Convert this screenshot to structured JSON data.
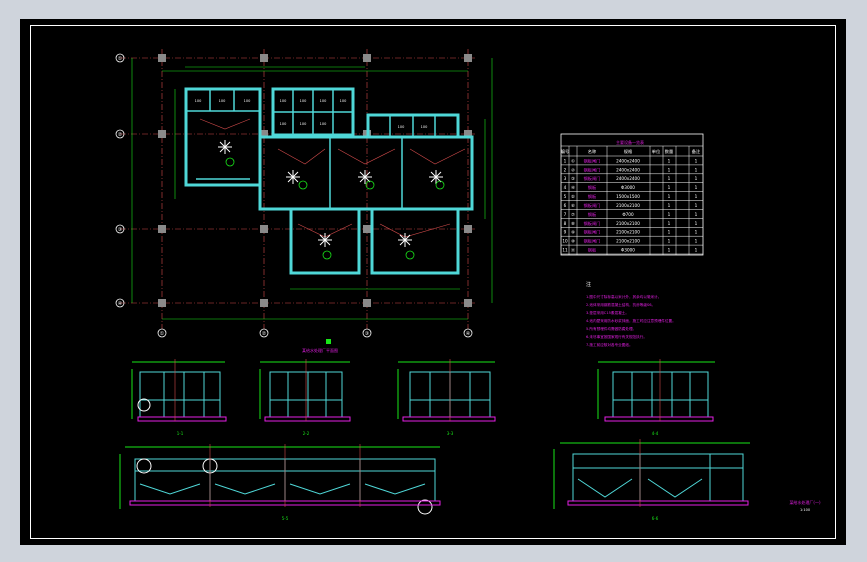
{
  "drawing": {
    "background": "#000000",
    "frame_color": "#ffffff",
    "line_colors": {
      "wall": "#4fd8d8",
      "dimension": "#19e619",
      "axis": "#d24b4b",
      "annotation": "#e41fe4",
      "text": "#ffffff"
    }
  },
  "plan": {
    "axis_labels_left": [
      "①",
      "②",
      "③",
      "④"
    ],
    "axis_labels_bottom": [
      "①",
      "②",
      "③",
      "④"
    ],
    "cell_labels_top": [
      "100",
      "100",
      "100",
      "100",
      "100",
      "100",
      "100",
      "100",
      "100",
      "100",
      "100",
      "100"
    ],
    "caption": "某给水处理厂平面图"
  },
  "table": {
    "title": "主要设备一览表",
    "headers": [
      "编号",
      "名称",
      "规格",
      "单位",
      "数量",
      "备注"
    ],
    "rows": [
      [
        "1",
        "①",
        "钢板闸门",
        "2400x2400",
        "1",
        "1"
      ],
      [
        "2",
        "②",
        "钢板闸门",
        "2400x2400",
        "1",
        "1"
      ],
      [
        "3",
        "③",
        "钢板闸门",
        "2400x2400",
        "1",
        "1"
      ],
      [
        "4",
        "④",
        "钢板",
        "Φ3000",
        "1",
        "1"
      ],
      [
        "5",
        "⑤",
        "钢板",
        "1500x1500",
        "1",
        "1"
      ],
      [
        "6",
        "⑥",
        "钢板闸门",
        "2100x2100",
        "1",
        "1"
      ],
      [
        "7",
        "⑦",
        "钢板",
        "Φ700",
        "1",
        "1"
      ],
      [
        "8",
        "⑧",
        "钢板闸门",
        "2100x2100",
        "1",
        "1"
      ],
      [
        "9",
        "⑨",
        "钢板闸门",
        "2100x2100",
        "1",
        "1"
      ],
      [
        "10",
        "⑩",
        "钢板闸门",
        "2100x2100",
        "1",
        "1"
      ],
      [
        "11",
        "⑪",
        "钢板",
        "Φ3000",
        "1",
        "1"
      ]
    ]
  },
  "notes": {
    "title": "注",
    "items": [
      "1.图中尺寸除标高以米计外，其余均以毫米计。",
      "2.池体采用钢筋混凝土结构，抗渗等级S6。",
      "3.垫层采用C15素混凝土。",
      "4.池内壁采用防水砂浆抹面，施工时应注意预埋件位置。",
      "5.所有预埋件均需做防腐处理。",
      "6.未尽事宜按国家现行有关规范执行。",
      "7.施工前应核对各专业图纸。"
    ]
  },
  "sections": {
    "labels": [
      "1-1",
      "2-2",
      "3-3",
      "4-4",
      "5-5",
      "6-6"
    ],
    "scale": "1:100"
  },
  "title_block": {
    "text": "某给水处理厂(一)",
    "scale": "1:100"
  }
}
